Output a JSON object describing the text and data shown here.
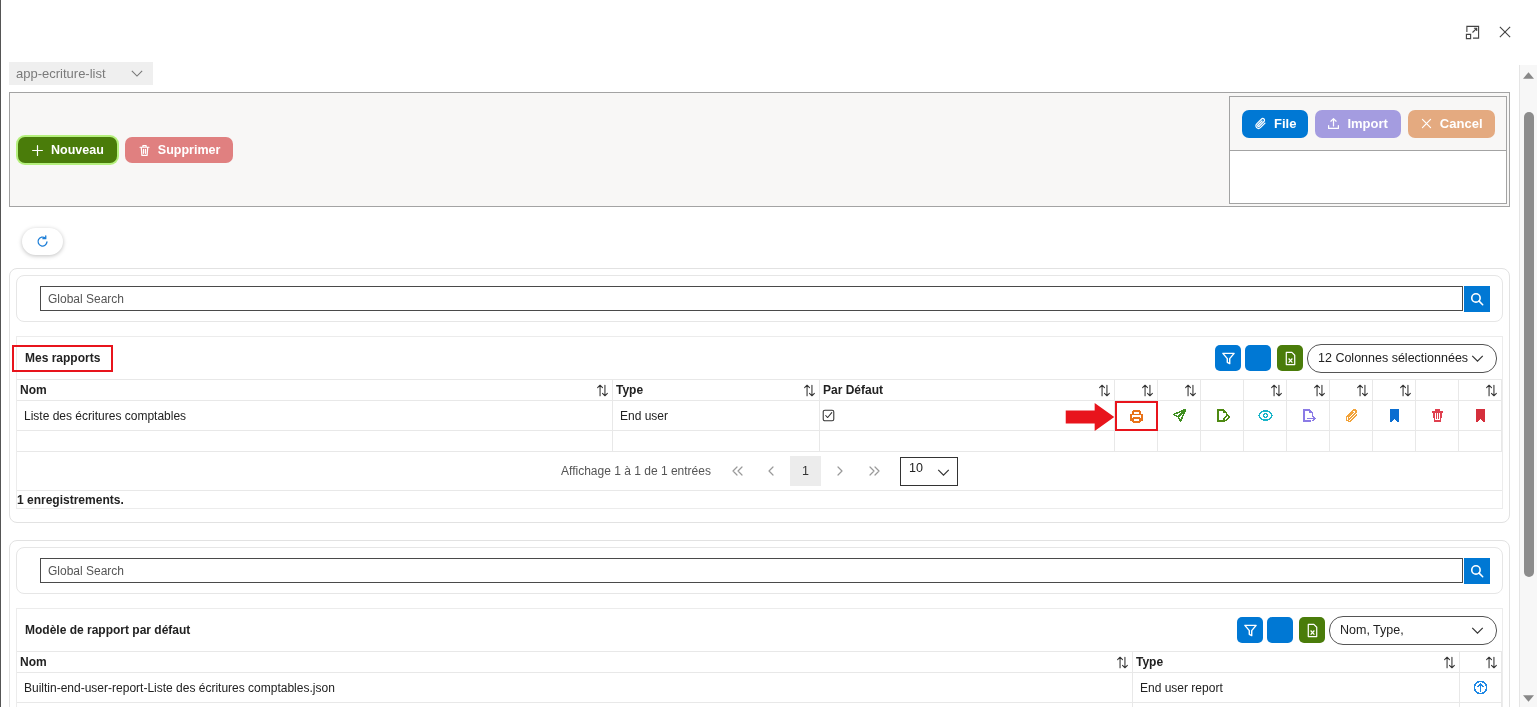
{
  "component_select": {
    "value": "app-ecriture-list",
    "disabled": true
  },
  "toolbar": {
    "buttons": [
      {
        "kind": "add",
        "label": "Nouveau",
        "disabled": false,
        "focused": true
      },
      {
        "kind": "delete",
        "label": "Supprimer",
        "disabled": true,
        "focused": false
      }
    ],
    "file_buttons": [
      {
        "kind": "file",
        "label": "File",
        "disabled": false
      },
      {
        "kind": "import",
        "label": "Import",
        "disabled": true
      },
      {
        "kind": "cancel",
        "label": "Cancel",
        "disabled": true
      }
    ]
  },
  "sections": [
    {
      "search": {
        "placeholder": "Global Search"
      },
      "title": {
        "text": "Mes rapports",
        "highlighted": true
      },
      "column_select": {
        "value": "12 Colonnes sélectionnées"
      },
      "columns": [
        {
          "label": "Nom",
          "sortable": true
        },
        {
          "label": "Type",
          "sortable": true
        },
        {
          "label": "Par Défaut",
          "sortable": true
        },
        {
          "sortable": true
        },
        {
          "sortable": true
        },
        {
          "sortable": false
        },
        {
          "sortable": true
        },
        {
          "sortable": true
        },
        {
          "sortable": true
        },
        {
          "sortable": true
        },
        {
          "sortable": false
        },
        {
          "sortable": true
        }
      ],
      "rows": [
        {
          "cells": [
            "Liste des écritures comptables",
            "End user"
          ],
          "default": true,
          "actions": [
            {
              "kind": "print",
              "color": "#e8731a",
              "highlighted": true,
              "arrow": true
            },
            {
              "kind": "send",
              "color": "#3f8f1f",
              "highlighted": false,
              "arrow": false
            },
            {
              "kind": "edit",
              "color": "#4e8a12",
              "highlighted": false,
              "arrow": false
            },
            {
              "kind": "view",
              "color": "#1ab5c9",
              "highlighted": false,
              "arrow": false
            },
            {
              "kind": "export",
              "color": "#8b7be6",
              "highlighted": false,
              "arrow": false
            },
            {
              "kind": "attach",
              "color": "#f2a33a",
              "highlighted": false,
              "arrow": false
            },
            {
              "kind": "bookmark",
              "color": "#0a6ed1",
              "highlighted": false,
              "arrow": false
            },
            {
              "kind": "delete",
              "color": "#e0404f",
              "highlighted": false,
              "arrow": false
            },
            {
              "kind": "bookmark",
              "color": "#d52f3c",
              "highlighted": false,
              "arrow": false
            }
          ]
        }
      ],
      "pagination": {
        "info": "Affichage 1 à 1 de 1 entrées",
        "pages": [
          {
            "label": "1",
            "selected": true
          }
        ],
        "page_size": "10"
      },
      "footer": "1 enregistrements."
    },
    {
      "search": {
        "placeholder": "Global Search"
      },
      "title": {
        "text": "Modèle de rapport par défaut",
        "highlighted": false
      },
      "column_select": {
        "value": "Nom, Type,"
      },
      "columns": [
        {
          "label": "Nom",
          "sortable": true
        },
        {
          "label": "Type",
          "sortable": true
        },
        {
          "sortable": true
        }
      ],
      "rows": [
        {
          "cells": [
            "Builtin-end-user-report-Liste des écritures comptables.json",
            "End user report"
          ],
          "actions": [
            {
              "kind": "circle-up"
            }
          ]
        }
      ]
    }
  ]
}
